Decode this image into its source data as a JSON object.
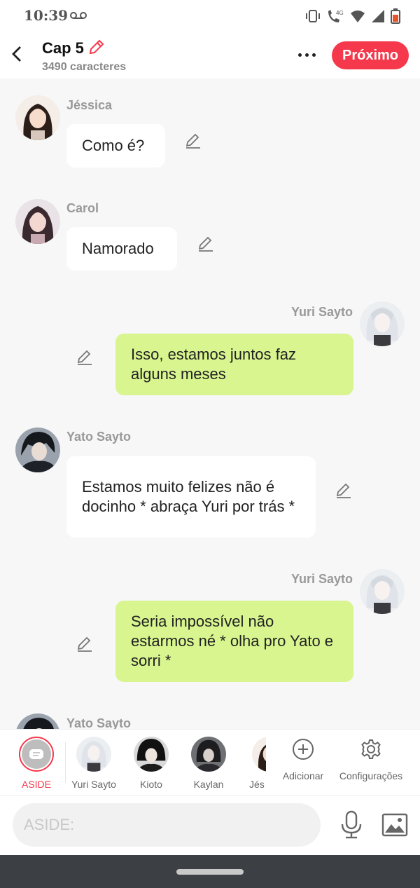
{
  "status": {
    "time": "10:39",
    "network": "4G"
  },
  "header": {
    "title": "Cap 5",
    "subtitle": "3490 caracteres",
    "next_label": "Próximo"
  },
  "messages": [
    {
      "side": "left",
      "name": "Jéssica",
      "text": "Como é?",
      "avatar": "jessica"
    },
    {
      "side": "left",
      "name": "Carol",
      "text": "Namorado",
      "avatar": "carol"
    },
    {
      "side": "right",
      "name": "Yuri Sayto",
      "text": "Isso, estamos juntos faz alguns meses",
      "avatar": "yuri"
    },
    {
      "side": "left",
      "name": "Yato Sayto",
      "text": "Estamos muito felizes não é docinho * abraça Yuri por trás *",
      "avatar": "yato"
    },
    {
      "side": "right",
      "name": "Yuri Sayto",
      "text": "Seria impossível não estarmos né * olha pro Yato e sorri *",
      "avatar": "yuri"
    },
    {
      "side": "left",
      "name": "Yato Sayto",
      "text": "",
      "avatar": "yato"
    }
  ],
  "characters": [
    {
      "name": "ASIDE",
      "active": true
    },
    {
      "name": "Yuri Sayto"
    },
    {
      "name": "Kioto"
    },
    {
      "name": "Kaylan"
    },
    {
      "name": "Jés"
    }
  ],
  "tools": {
    "add_label": "Adicionar",
    "settings_label": "Configurações"
  },
  "input": {
    "placeholder": "ASIDE:"
  },
  "colors": {
    "accent": "#f5384b",
    "bubble_right": "#d8f58f",
    "bubble_left": "#ffffff"
  }
}
